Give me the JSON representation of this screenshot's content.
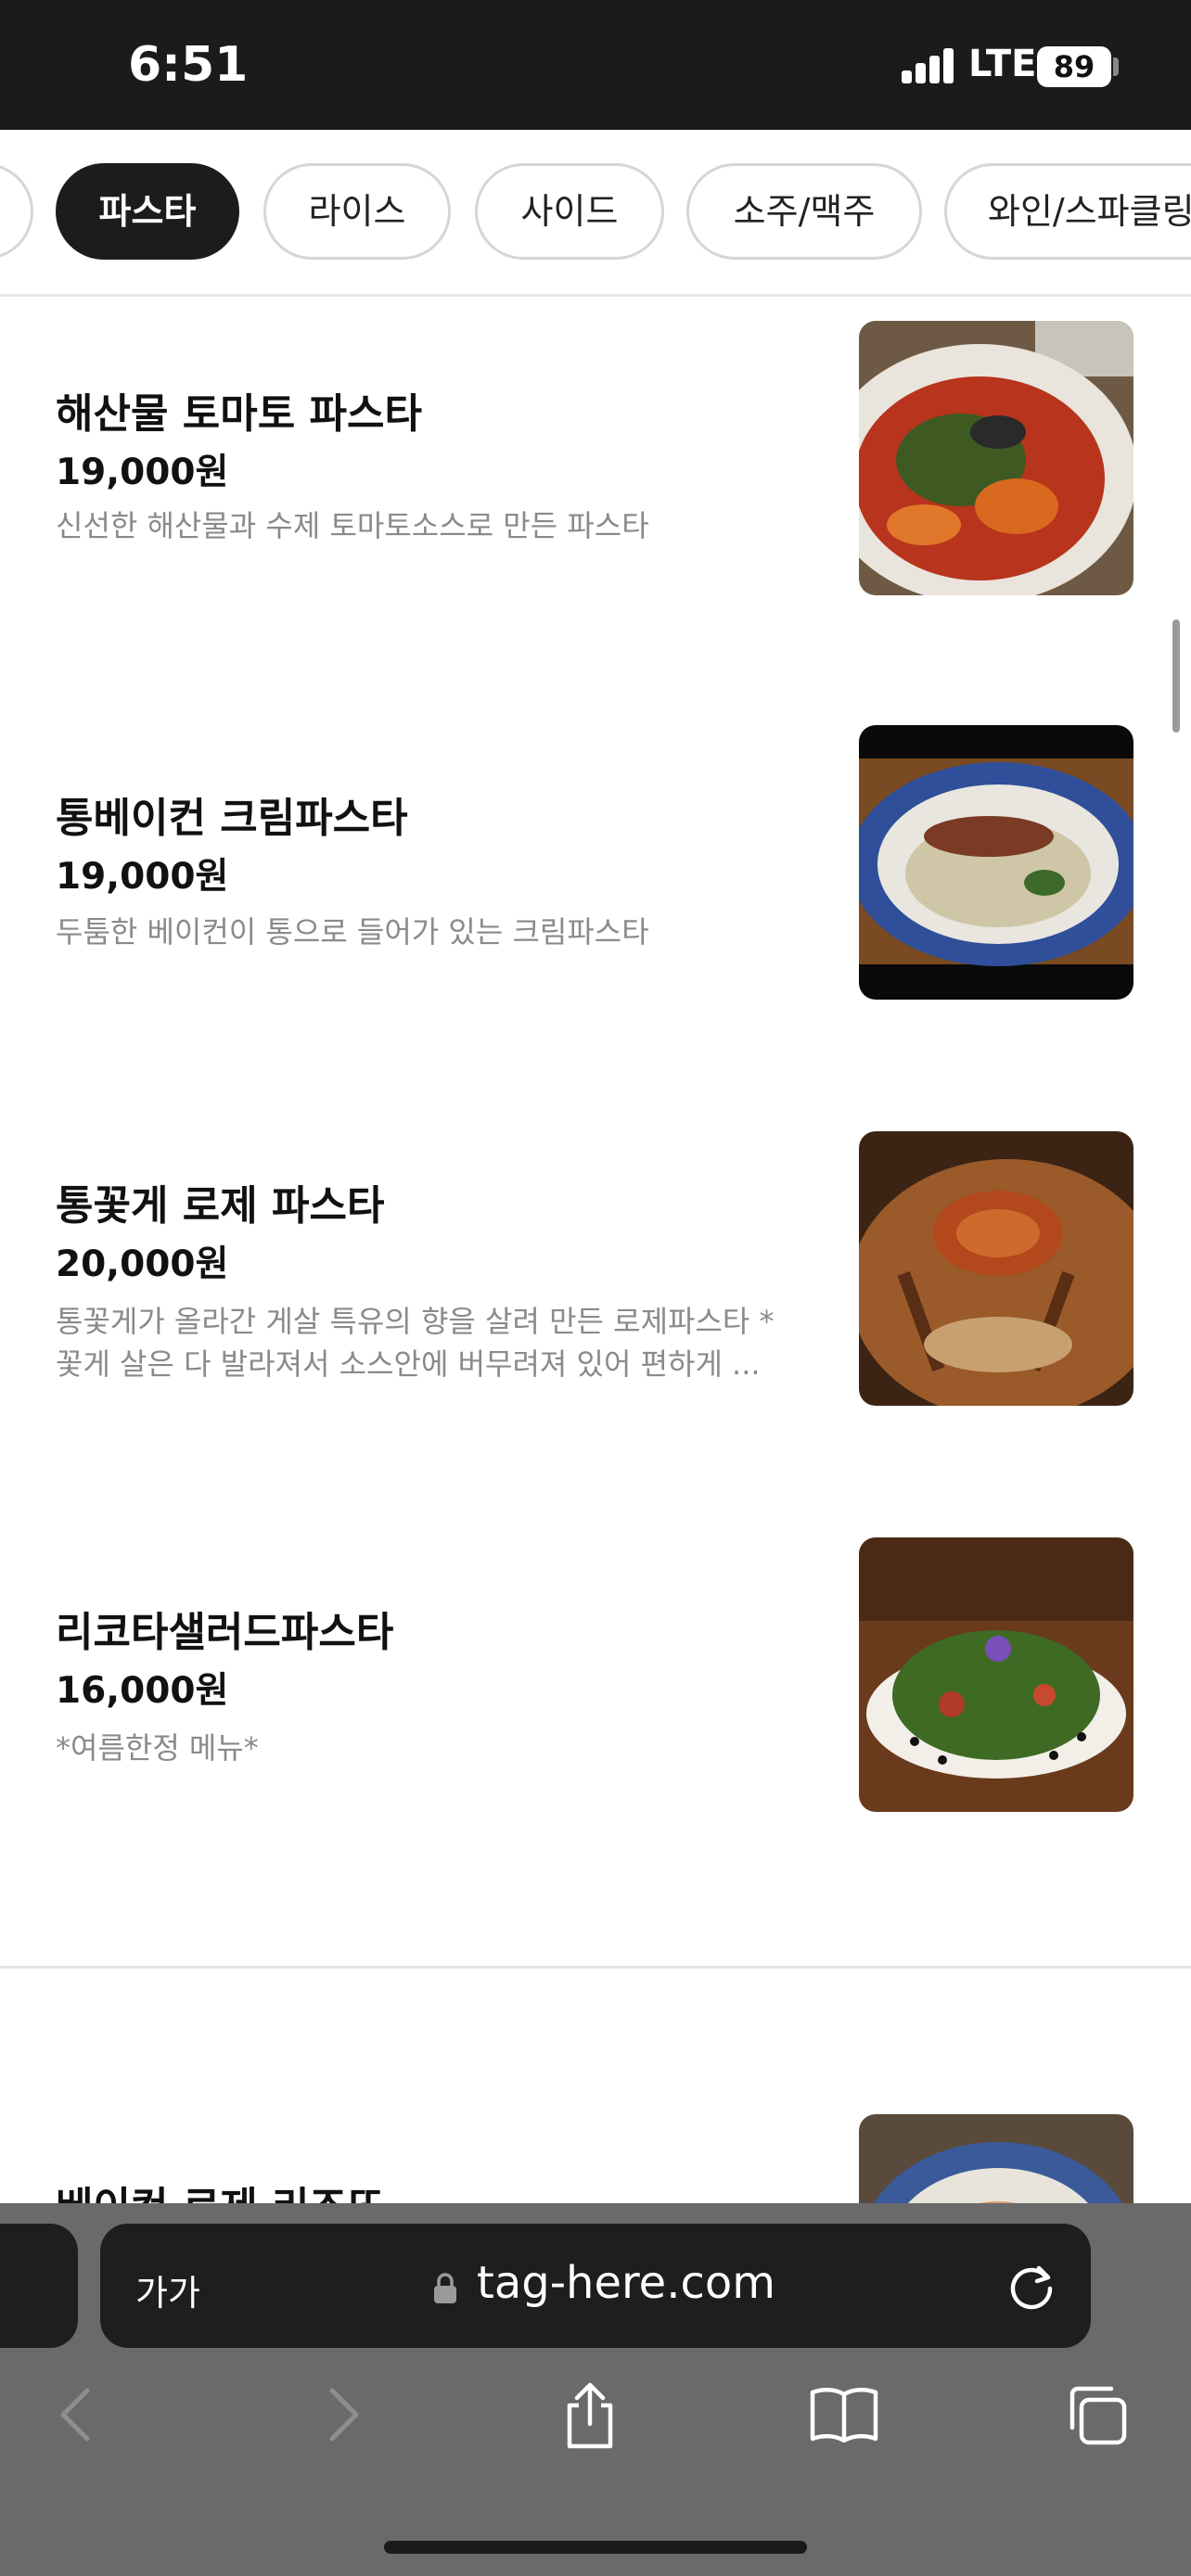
{
  "status_bar": {
    "time": "6:51",
    "network": "LTE",
    "battery": "89"
  },
  "tabs": [
    {
      "label": ""
    },
    {
      "label": "파스타",
      "active": true
    },
    {
      "label": "라이스"
    },
    {
      "label": "사이드"
    },
    {
      "label": "소주/맥주"
    },
    {
      "label": "와인/스파클링"
    }
  ],
  "menu": {
    "items": [
      {
        "name": "해산물 토마토 파스타",
        "price": "19,000원",
        "desc": "신선한 해산물과 수제 토마토소스로 만든 파스타"
      },
      {
        "name": "통베이컨 크림파스타",
        "price": "19,000원",
        "desc": "두툼한 베이컨이 통으로 들어가 있는 크림파스타"
      },
      {
        "name": "통꽃게 로제 파스타",
        "price": "20,000원",
        "desc": "통꽃게가 올라간 게살 특유의 향을 살려 만든 로제파스타 * 꽃게 살은 다 발라져서 소스안에 버무려져 있어 편하게 ..."
      },
      {
        "name": "리코타샐러드파스타",
        "price": "16,000원",
        "desc": "*여름한정 메뉴*"
      },
      {
        "name": "베이컨 로제 리조또"
      }
    ]
  },
  "browser": {
    "text_size": "가가",
    "url": "tag-here.com"
  },
  "colors": {
    "dark": "#1c1c1c",
    "muted": "#8a8a8a",
    "toolbar": "#6a6a6a"
  }
}
